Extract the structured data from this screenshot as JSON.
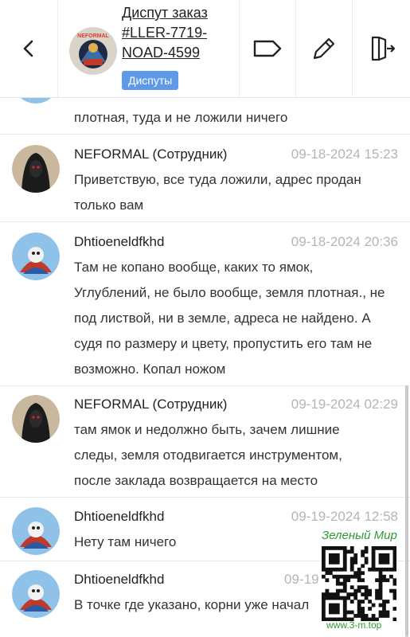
{
  "header": {
    "title_lines": [
      "Диспут заказ",
      "#LLER-7719-",
      "NOAD-4599"
    ],
    "badge": "Диспуты",
    "back_icon": "chevron-left-icon",
    "actions": [
      {
        "name": "tag-button",
        "icon": "tag-icon"
      },
      {
        "name": "edit-button",
        "icon": "pencil-icon"
      },
      {
        "name": "exit-button",
        "icon": "exit-door-icon"
      }
    ],
    "avatar_logo_text": "NEFORMAL"
  },
  "messages": [
    {
      "author": "",
      "time": "",
      "lines": [
        "плотная, туда и не ложили ничего"
      ],
      "avatar": "user-avatar-cat"
    },
    {
      "author": "NEFORMAL (Сотрудник)",
      "time": "09-18-2024 15:23",
      "lines": [
        "Приветствую, все туда ложили, адрес продан",
        "только вам"
      ],
      "avatar": "staff-avatar-hooded"
    },
    {
      "author": "Dhtioeneldfkhd",
      "time": "09-18-2024 20:36",
      "lines": [
        "Там не копано вообще, каких то ямок,",
        "Углублений, не было вообще, земля плотная., не",
        "под листвой, ни в земле, адреса не найдено. А",
        "судя по размеру и цвету, пропустить его там не",
        "возможно. Копал ножом"
      ],
      "avatar": "user-avatar-cat"
    },
    {
      "author": "NEFORMAL (Сотрудник)",
      "time": "09-19-2024 02:29",
      "lines": [
        "там ямок и недолжно быть, зачем лишние",
        "следы, земля отодвигается инструментом,",
        "после заклада возвращается на место"
      ],
      "avatar": "staff-avatar-hooded"
    },
    {
      "author": "Dhtioeneldfkhd",
      "time": "09-19-2024 12:58",
      "lines": [
        "Нету там ничего"
      ],
      "avatar": "user-avatar-cat"
    },
    {
      "author": "Dhtioeneldfkhd",
      "time": "09-19",
      "lines": [
        "В точке где указано, корни уже начал"
      ],
      "avatar": "user-avatar-cat"
    }
  ],
  "watermark": {
    "label": "Зеленый Мир",
    "url": "www.3-m.top",
    "color": "#2e9b32"
  },
  "colors": {
    "badge": "#5e9ae8",
    "timestamp": "#b5b5b5"
  }
}
